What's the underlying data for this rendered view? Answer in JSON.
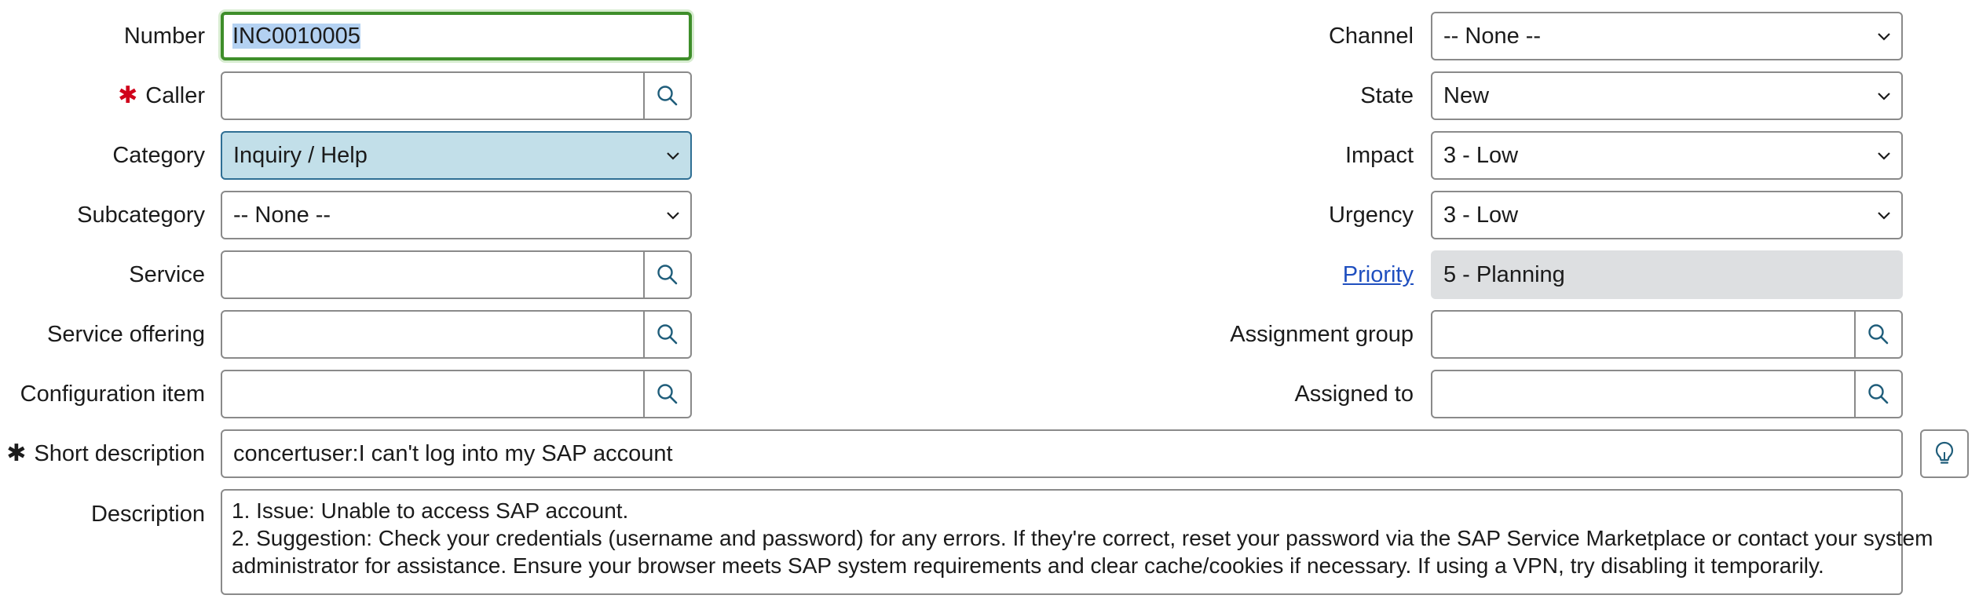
{
  "form": {
    "left": {
      "number": {
        "label": "Number",
        "value": "INC0010005"
      },
      "caller": {
        "label": "Caller",
        "required_mark": "✱",
        "value": ""
      },
      "category": {
        "label": "Category",
        "value": "Inquiry / Help"
      },
      "subcategory": {
        "label": "Subcategory",
        "value": "-- None --"
      },
      "service": {
        "label": "Service",
        "value": ""
      },
      "service_offering": {
        "label": "Service offering",
        "value": ""
      },
      "configuration_item": {
        "label": "Configuration item",
        "value": ""
      }
    },
    "right": {
      "channel": {
        "label": "Channel",
        "value": "-- None --"
      },
      "state": {
        "label": "State",
        "value": "New"
      },
      "impact": {
        "label": "Impact",
        "value": "3 - Low"
      },
      "urgency": {
        "label": "Urgency",
        "value": "3 - Low"
      },
      "priority": {
        "label": "Priority",
        "value": "5 - Planning"
      },
      "assignment_group": {
        "label": "Assignment group",
        "value": ""
      },
      "assigned_to": {
        "label": "Assigned to",
        "value": ""
      }
    },
    "short_description": {
      "label": "Short description",
      "required_mark": "✱",
      "value": "concertuser:I can't log into my SAP account"
    },
    "description": {
      "label": "Description",
      "lines": [
        "1. Issue: Unable to access SAP account.",
        "2. Suggestion: Check your credentials (username and password) for any errors. If they're correct, reset your password via the SAP Service Marketplace or contact your system",
        "administrator for assistance. Ensure your browser meets SAP system requirements and clear cache/cookies if necessary. If using a VPN, try disabling it temporarily."
      ]
    }
  },
  "icons": {
    "lookup": "search-icon",
    "dropdown": "chevron-down-icon",
    "suggestion": "lightbulb-icon"
  },
  "colors": {
    "focus_border": "#3e8e2a",
    "required_caller": "#d0021b",
    "category_bg": "#c2dfe9",
    "readonly_bg": "#dddfe1",
    "link": "#1f4fbf",
    "icon_blue": "#1f5d7a"
  }
}
